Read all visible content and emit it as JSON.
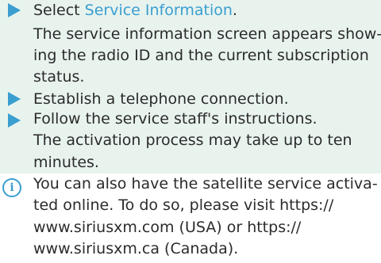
{
  "steps": [
    {
      "icon": "arrow-right-icon",
      "lines": [
        "Select ",
        "The service information screen appears show-",
        "ing the radio ID and the current subscription",
        "status."
      ],
      "link": "Service Information",
      "link_suffix": "."
    },
    {
      "icon": "arrow-right-icon",
      "lines": [
        "Establish a telephone connection."
      ]
    },
    {
      "icon": "arrow-right-icon",
      "lines": [
        "Follow the service staff's instructions.",
        "The activation process may take up to ten",
        "minutes."
      ]
    }
  ],
  "note": {
    "icon": "info-icon",
    "symbol": "i",
    "lines": [
      "You can also have the satellite service activa-",
      "ted online. To do so, please visit https://",
      "www.siriusxm.com (USA) or https://",
      "www.siriusxm.ca (Canada)."
    ]
  },
  "colors": {
    "accent": "#3a9ed0",
    "step_background": "#e8f3ee",
    "text": "#2b2b2b"
  }
}
